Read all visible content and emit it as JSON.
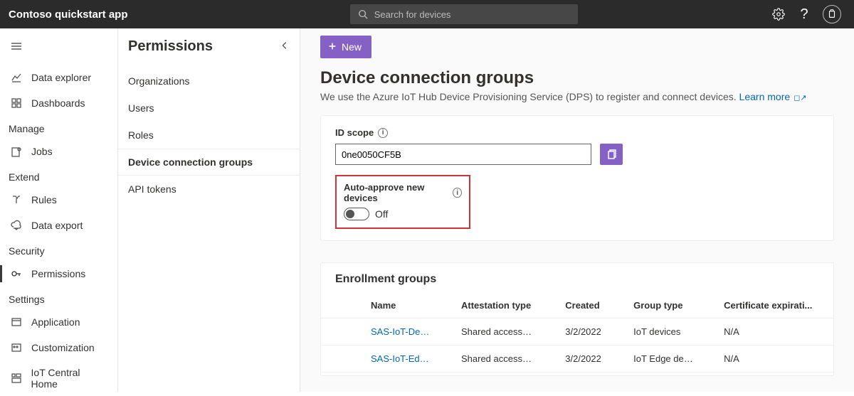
{
  "header": {
    "app_title": "Contoso quickstart app",
    "search_placeholder": "Search for devices"
  },
  "rail": {
    "items": [
      {
        "icon": "data-explorer",
        "label": "Data explorer"
      },
      {
        "icon": "dashboards",
        "label": "Dashboards"
      }
    ],
    "manage_label": "Manage",
    "manage_items": [
      {
        "icon": "jobs",
        "label": "Jobs"
      }
    ],
    "extend_label": "Extend",
    "extend_items": [
      {
        "icon": "rules",
        "label": "Rules"
      },
      {
        "icon": "data-export",
        "label": "Data export"
      }
    ],
    "security_label": "Security",
    "security_items": [
      {
        "icon": "permissions",
        "label": "Permissions"
      }
    ],
    "settings_label": "Settings",
    "settings_items": [
      {
        "icon": "application",
        "label": "Application"
      },
      {
        "icon": "customization",
        "label": "Customization"
      },
      {
        "icon": "iot-central-home",
        "label": "IoT Central Home"
      }
    ]
  },
  "panel2": {
    "title": "Permissions",
    "items": [
      {
        "label": "Organizations"
      },
      {
        "label": "Users"
      },
      {
        "label": "Roles"
      },
      {
        "label": "Device connection groups",
        "active": true
      },
      {
        "label": "API tokens"
      }
    ]
  },
  "main": {
    "new_button": "New",
    "page_title": "Device connection groups",
    "page_desc": "We use the Azure IoT Hub Device Provisioning Service (DPS) to register and connect devices.",
    "learn_more": "Learn more",
    "id_scope_label": "ID scope",
    "id_scope_value": "0ne0050CF5B",
    "auto_approve_label": "Auto-approve new devices",
    "auto_approve_state": "Off",
    "enrollment_title": "Enrollment groups",
    "table": {
      "headers": [
        "",
        "Name",
        "Attestation type",
        "Created",
        "Group type",
        "Certificate expirati..."
      ],
      "rows": [
        {
          "name": "SAS-IoT-Devi…",
          "attest": "Shared access…",
          "created": "3/2/2022",
          "group": "IoT devices",
          "cert": "N/A"
        },
        {
          "name": "SAS-IoT-Edge…",
          "attest": "Shared access…",
          "created": "3/2/2022",
          "group": "IoT Edge devi…",
          "cert": "N/A"
        }
      ]
    }
  },
  "colors": {
    "accent": "#8661c5",
    "link": "#0067b8",
    "danger": "#d13438"
  }
}
